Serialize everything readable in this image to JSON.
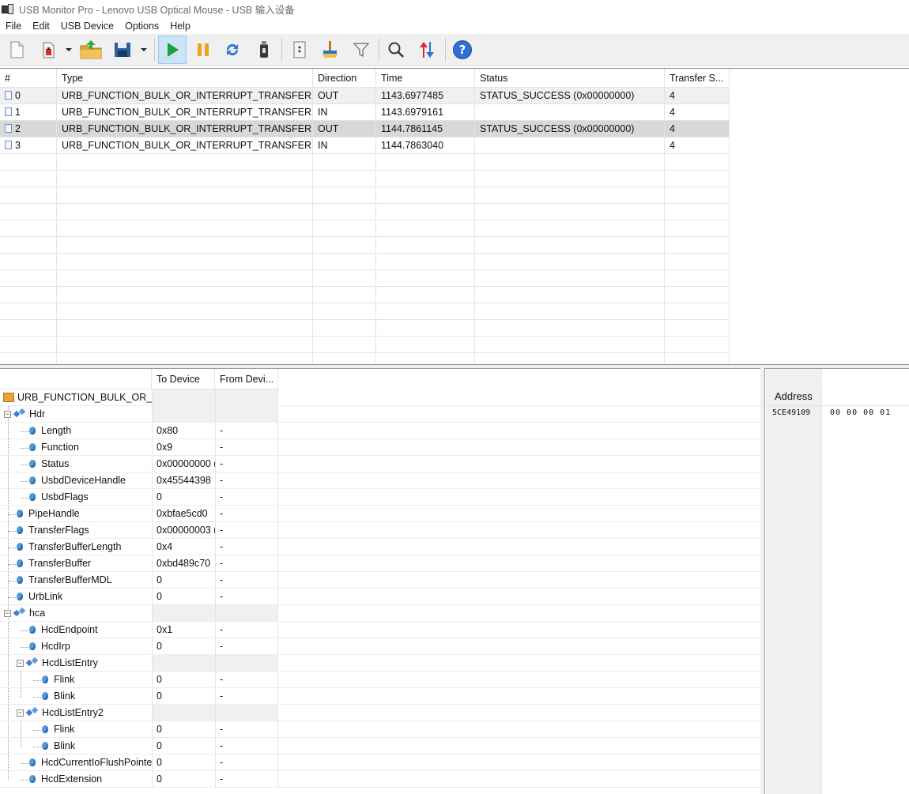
{
  "window": {
    "title": "USB Monitor Pro - Lenovo USB Optical Mouse - USB 输入设备"
  },
  "menu": [
    "File",
    "Edit",
    "USB Device",
    "Options",
    "Help"
  ],
  "toolbar": {
    "buttons": [
      "new-document",
      "save-log",
      "open-folder",
      "save",
      "start",
      "pause",
      "refresh",
      "usb-device",
      "properties",
      "clear",
      "filter",
      "search",
      "sort",
      "help"
    ],
    "accent_play": "#1aa33a",
    "accent_pause": "#f0a020",
    "accent_help": "#2f6fd6"
  },
  "requests": {
    "columns": [
      "#",
      "Type",
      "Direction",
      "Time",
      "Status",
      "Transfer S..."
    ],
    "rows": [
      {
        "num": "0",
        "type": "URB_FUNCTION_BULK_OR_INTERRUPT_TRANSFER",
        "direction": "OUT",
        "time": "1143.6977485",
        "status": "STATUS_SUCCESS (0x00000000)",
        "size": "4"
      },
      {
        "num": "1",
        "type": "URB_FUNCTION_BULK_OR_INTERRUPT_TRANSFER",
        "direction": "IN",
        "time": "1143.6979161",
        "status": "",
        "size": "4"
      },
      {
        "num": "2",
        "type": "URB_FUNCTION_BULK_OR_INTERRUPT_TRANSFER",
        "direction": "OUT",
        "time": "1144.7861145",
        "status": "STATUS_SUCCESS (0x00000000)",
        "size": "4"
      },
      {
        "num": "3",
        "type": "URB_FUNCTION_BULK_OR_INTERRUPT_TRANSFER",
        "direction": "IN",
        "time": "1144.7863040",
        "status": "",
        "size": "4"
      }
    ]
  },
  "details": {
    "columns": [
      "",
      "To Device",
      "From Devi..."
    ],
    "root": "URB_FUNCTION_BULK_OR_IN",
    "rows": [
      {
        "name": "Hdr",
        "to": "",
        "from": "",
        "kind": "group"
      },
      {
        "name": "Length",
        "to": "0x80",
        "from": "-"
      },
      {
        "name": "Function",
        "to": "0x9",
        "from": "-"
      },
      {
        "name": "Status",
        "to": "0x00000000 (",
        "from": "-"
      },
      {
        "name": "UsbdDeviceHandle",
        "to": "0x45544398",
        "from": "-"
      },
      {
        "name": "UsbdFlags",
        "to": "0",
        "from": "-"
      },
      {
        "name": "PipeHandle",
        "to": "0xbfae5cd0",
        "from": "-"
      },
      {
        "name": "TransferFlags",
        "to": "0x00000003 (",
        "from": "-"
      },
      {
        "name": "TransferBufferLength",
        "to": "0x4",
        "from": "-"
      },
      {
        "name": "TransferBuffer",
        "to": "0xbd489c70",
        "from": "-"
      },
      {
        "name": "TransferBufferMDL",
        "to": "0",
        "from": "-"
      },
      {
        "name": "UrbLink",
        "to": "0",
        "from": "-"
      },
      {
        "name": "hca",
        "to": "",
        "from": "",
        "kind": "group"
      },
      {
        "name": "HcdEndpoint",
        "to": "0x1",
        "from": "-"
      },
      {
        "name": "HcdIrp",
        "to": "0",
        "from": "-"
      },
      {
        "name": "HcdListEntry",
        "to": "",
        "from": "",
        "kind": "group"
      },
      {
        "name": "Flink",
        "to": "0",
        "from": "-"
      },
      {
        "name": "Blink",
        "to": "0",
        "from": "-"
      },
      {
        "name": "HcdListEntry2",
        "to": "",
        "from": "",
        "kind": "group"
      },
      {
        "name": "Flink",
        "to": "0",
        "from": "-"
      },
      {
        "name": "Blink",
        "to": "0",
        "from": "-"
      },
      {
        "name": "HcdCurrentIoFlushPointer",
        "to": "0",
        "from": "-"
      },
      {
        "name": "HcdExtension",
        "to": "0",
        "from": "-"
      }
    ]
  },
  "hex": {
    "header": "Address",
    "address": "5CE49109",
    "bytes": "00 00 00 01"
  }
}
